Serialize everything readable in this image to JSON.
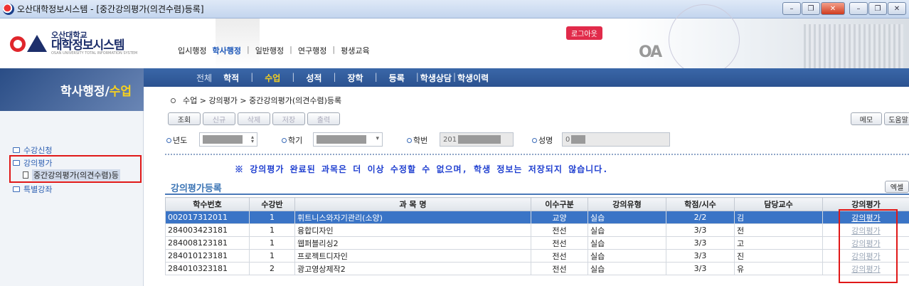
{
  "window": {
    "title": "오산대학정보시스템 - [중간강의평가(의견수렴)등록]",
    "min": "–",
    "restore": "❐",
    "close": "✕"
  },
  "logo": {
    "line1": "오산대학교",
    "line2": "대학정보시스템",
    "en": "OSAN UNIVERSITY TOTAL INFORMATION SYSTEM"
  },
  "topnav": {
    "items": [
      "입시행정",
      "학사행정",
      "일반행정",
      "연구행정",
      "평생교육"
    ],
    "active": "학사행정"
  },
  "logout": "로그아웃",
  "sidebar": {
    "title": "학사행정",
    "subtitle": "수업",
    "items": [
      {
        "label": "수강신청"
      },
      {
        "label": "강의평가"
      },
      {
        "label": "중간강의평가(의견수렴)등"
      },
      {
        "label": "특별강좌"
      }
    ]
  },
  "menu": {
    "items": [
      "전체",
      "학적",
      "수업",
      "성적",
      "장학",
      "등록",
      "학생상담",
      "학생이력"
    ],
    "active": "수업"
  },
  "breadcrumb": "수업 > 강의평가 > 중간강의평가(의견수렴)등록",
  "buttons": {
    "search": "조회",
    "new": "신규",
    "delete": "삭제",
    "save": "저장",
    "print": "출력",
    "memo": "메모",
    "help": "도움말",
    "excel": "엑셀"
  },
  "form": {
    "year_label": "년도",
    "term_label": "학기",
    "id_label": "학번",
    "id_value": "201",
    "name_label": "성명",
    "name_value": "0"
  },
  "notice": "※ 강의평가 완료된 과목은 더 이상 수정할 수 없으며, 학생 정보는 저장되지 않습니다.",
  "section_title": "강의평가등록",
  "table": {
    "headers": [
      "학수번호",
      "수강반",
      "과 목 명",
      "이수구분",
      "강의유형",
      "학점/시수",
      "담당교수",
      "강의평가"
    ],
    "rows": [
      {
        "code": "002017312011",
        "cls": "1",
        "name": "휘트니스와자기관리(소양)",
        "type": "교양",
        "lec": "실습",
        "credit": "2/2",
        "prof": "김",
        "eval": "강의평가"
      },
      {
        "code": "284003423181",
        "cls": "1",
        "name": "융합디자인",
        "type": "전선",
        "lec": "실습",
        "credit": "3/3",
        "prof": "전",
        "eval": "강의평가"
      },
      {
        "code": "284008123181",
        "cls": "1",
        "name": "웹퍼블리싱2",
        "type": "전선",
        "lec": "실습",
        "credit": "3/3",
        "prof": "고",
        "eval": "강의평가"
      },
      {
        "code": "284010123181",
        "cls": "1",
        "name": "프로젝트디자인",
        "type": "전선",
        "lec": "실습",
        "credit": "3/3",
        "prof": "진",
        "eval": "강의평가"
      },
      {
        "code": "284010323181",
        "cls": "2",
        "name": "광고영상제작2",
        "type": "전선",
        "lec": "실습",
        "credit": "3/3",
        "prof": "유",
        "eval": "강의평가"
      }
    ]
  }
}
